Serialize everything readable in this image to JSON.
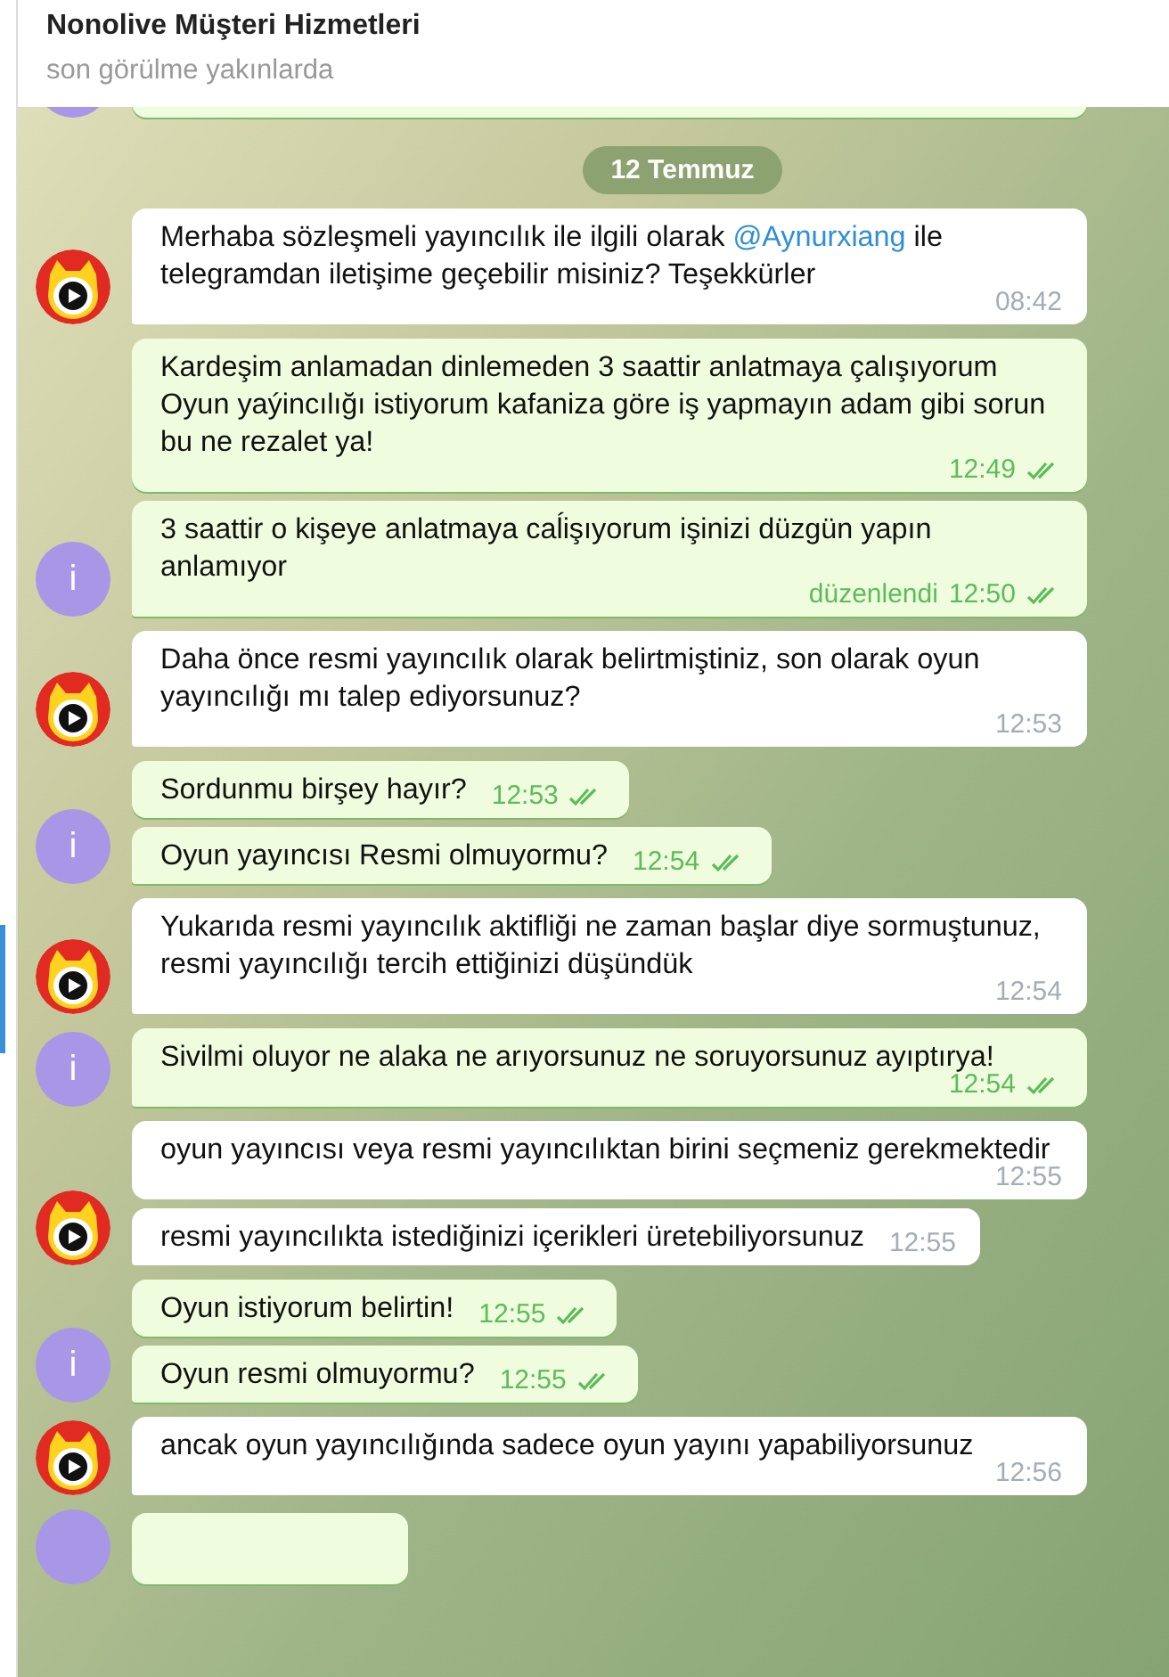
{
  "header": {
    "title": "Nonolive Müşteri Hizmetleri",
    "status": "son görülme yakınlarda"
  },
  "date_badge": "12 Temmuz",
  "groups": [
    {
      "kind": "in",
      "messages": [
        {
          "parts": [
            {
              "text": "Merhaba sözleşmeli yayıncılık ile ilgili olarak "
            },
            {
              "kind": "mention",
              "text": "@Aynurxiang"
            },
            {
              "text": " ile telegramdan iletişime geçebilir misiniz? Teşekkürler"
            }
          ],
          "time": "08:42"
        }
      ]
    },
    {
      "kind": "out",
      "avatar_letter": "i",
      "messages": [
        {
          "parts": [
            {
              "text": "Kardeşim anlamadan dinlemeden 3 saattir anlatmaya çalışıyorum Oyun yaýincılığı istiyorum kafaniza göre iş yapmayın adam gibi sorun bu ne rezalet ya!"
            }
          ],
          "time": "12:49",
          "read": true
        },
        {
          "parts": [
            {
              "text": "3 saattir o kişeye anlatmaya caĺişıyorum işinizi düzgün yapın anlamıyor"
            }
          ],
          "edited_label": "düzenlendi",
          "time": "12:50",
          "read": true
        }
      ]
    },
    {
      "kind": "in",
      "messages": [
        {
          "parts": [
            {
              "text": "Daha önce resmi yayıncılık olarak belirtmiştiniz, son olarak oyun yayıncılığı mı talep ediyorsunuz?"
            }
          ],
          "time": "12:53"
        }
      ]
    },
    {
      "kind": "out",
      "avatar_letter": "i",
      "messages": [
        {
          "parts": [
            {
              "text": "Sordunmu birşey hayır?"
            }
          ],
          "time": "12:53",
          "read": true
        },
        {
          "parts": [
            {
              "text": "Oyun yayıncısı Resmi olmuyormu?"
            }
          ],
          "time": "12:54",
          "read": true
        }
      ]
    },
    {
      "kind": "in",
      "messages": [
        {
          "parts": [
            {
              "text": "Yukarıda resmi yayıncılık aktifliği ne zaman başlar diye sormuştunuz, resmi yayıncılığı tercih ettiğinizi düşündük"
            }
          ],
          "time": "12:54"
        }
      ]
    },
    {
      "kind": "out",
      "avatar_letter": "i",
      "messages": [
        {
          "parts": [
            {
              "text": "Sivilmi oluyor ne alaka ne arıyorsunuz ne soruyorsunuz ayıptırya!"
            }
          ],
          "time": "12:54",
          "read": true
        }
      ]
    },
    {
      "kind": "in",
      "messages": [
        {
          "parts": [
            {
              "text": "oyun yayıncısı veya resmi yayıncılıktan birini seçmeniz gerekmektedir"
            }
          ],
          "time": "12:55"
        },
        {
          "parts": [
            {
              "text": "resmi yayıncılıkta istediğinizi içerikleri üretebiliyorsunuz"
            }
          ],
          "time": "12:55"
        }
      ]
    },
    {
      "kind": "out",
      "avatar_letter": "i",
      "messages": [
        {
          "parts": [
            {
              "text": "Oyun istiyorum belirtin!"
            }
          ],
          "time": "12:55",
          "read": true
        },
        {
          "parts": [
            {
              "text": "Oyun resmi olmuyormu?"
            }
          ],
          "time": "12:55",
          "read": true
        }
      ]
    },
    {
      "kind": "in",
      "messages": [
        {
          "parts": [
            {
              "text": "ancak oyun yayıncılığında sadece oyun yayını yapabiliyorsunuz"
            }
          ],
          "time": "12:56"
        }
      ]
    }
  ]
}
